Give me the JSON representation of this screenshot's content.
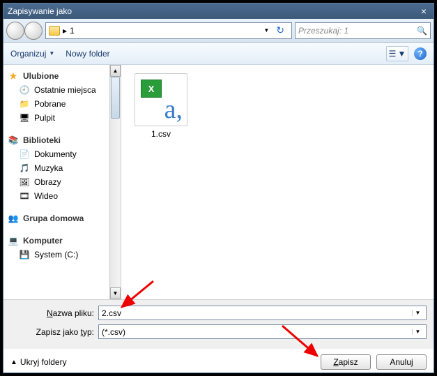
{
  "title": "Zapisywanie jako",
  "address": {
    "path": "1",
    "chevron": "▸"
  },
  "search": {
    "placeholder": "Przeszukaj: 1"
  },
  "toolbar": {
    "organize": "Organizuj",
    "newfolder": "Nowy folder"
  },
  "sidebar": {
    "fav": {
      "head": "Ulubione",
      "items": [
        "Ostatnie miejsca",
        "Pobrane",
        "Pulpit"
      ]
    },
    "lib": {
      "head": "Biblioteki",
      "items": [
        "Dokumenty",
        "Muzyka",
        "Obrazy",
        "Wideo"
      ]
    },
    "home": {
      "head": "Grupa domowa"
    },
    "comp": {
      "head": "Komputer",
      "items": [
        "System (C:)"
      ]
    }
  },
  "files": [
    {
      "name": "1.csv"
    }
  ],
  "fields": {
    "name_label": "Nazwa pliku:",
    "name_value": "2.csv",
    "type_label": "Zapisz jako typ:",
    "type_value": "(*.csv)"
  },
  "actions": {
    "hide": "Ukryj foldery",
    "save": "Zapisz",
    "cancel": "Anuluj"
  }
}
